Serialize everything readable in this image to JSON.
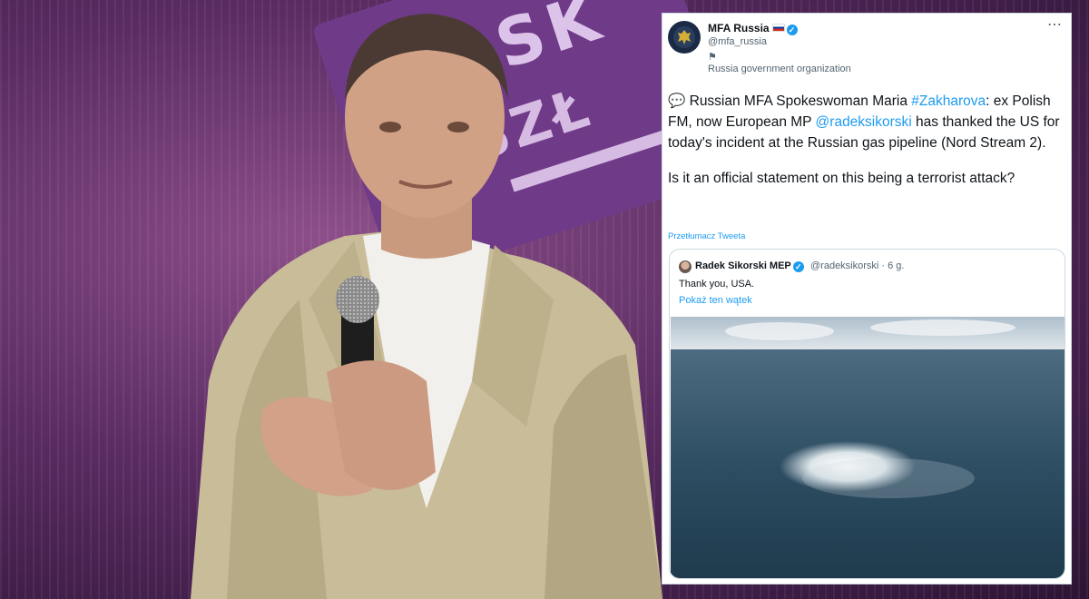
{
  "background": {
    "sign_text_1": "OLSK",
    "sign_text_2": "YSZŁ"
  },
  "tweet": {
    "author_name": "MFA Russia",
    "author_handle": "@mfa_russia",
    "flag_glyph": "⚑",
    "account_label": "Russia government organization",
    "more_glyph": "⋯",
    "body": {
      "bubble_icon": "💬",
      "line1_a": " Russian MFA Spokeswoman Maria ",
      "hashtag": "#Zakharova",
      "line1_b": ": ex Polish FM, now European MP ",
      "mention": "@radeksikorski",
      "line1_c": " has thanked the US for today's incident at the Russian gas pipeline (Nord Stream 2).",
      "paragraph2": "Is it an official statement on this being a terrorist attack?"
    },
    "translate_link": "Przetłumacz Tweeta",
    "quoted": {
      "author_name": "Radek Sikorski MEP",
      "author_handle": "@radeksikorski · 6 g.",
      "text": "Thank you, USA.",
      "thread_link": "Pokaż ten wątek"
    }
  },
  "colors": {
    "link": "#1d9bf0",
    "text": "#0f1419",
    "secondary": "#536471",
    "stage_purple": "#5b2c63"
  }
}
